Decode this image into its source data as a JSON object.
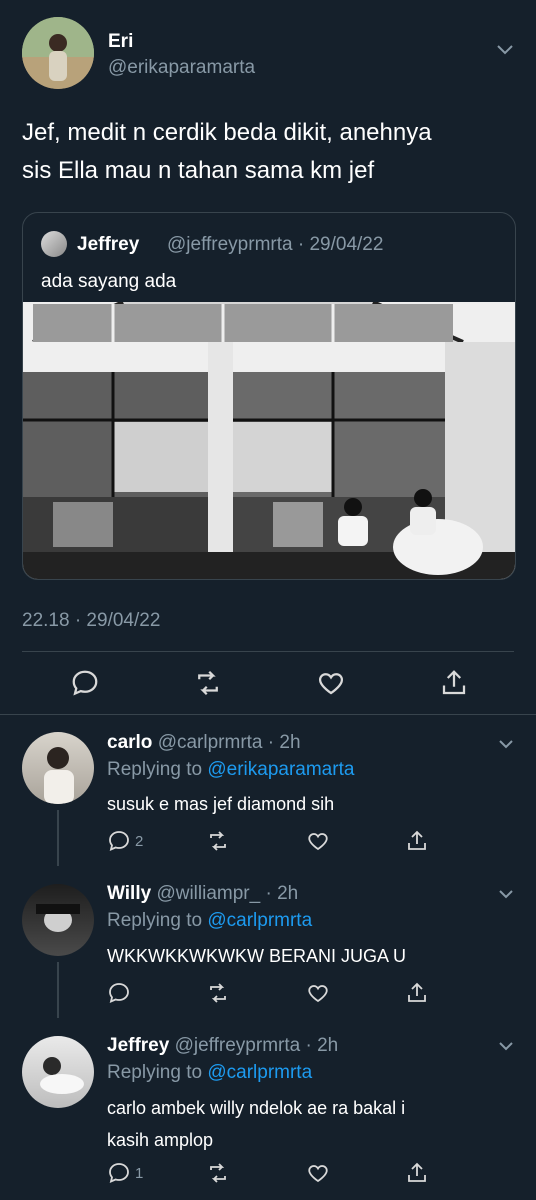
{
  "main_tweet": {
    "author_name": "Eri",
    "author_handle": "@erikaparamarta",
    "text_line1": "Jef, medit n cerdik beda dikit, anehnya",
    "text_line2": "sis Ella mau n tahan sama km jef",
    "quote": {
      "name": "Jeffrey",
      "meta": "@jeffreyprmrta · 29/04/22",
      "text": "ada sayang ada"
    },
    "timestamp": "22.18 · 29/04/22",
    "actions": [
      "reply-icon",
      "retweet-icon",
      "like-icon",
      "share-icon"
    ]
  },
  "replies": [
    {
      "name": "carlo",
      "meta": "@carlprmrta · 2h",
      "replying_prefix": "Replying to",
      "replying_to": "@erikaparamarta",
      "text": "susuk e mas jef diamond sih",
      "reply_count": "2"
    },
    {
      "name": "Willy",
      "meta": "@williampr_ · 2h",
      "replying_prefix": "Replying to",
      "replying_to": "@carlprmrta",
      "text": "WKKWKKWKWKW BERANI JUGA U",
      "reply_count": ""
    },
    {
      "name": "Jeffrey",
      "meta": "@jeffreyprmrta · 2h",
      "replying_prefix": "Replying to",
      "replying_to": "@carlprmrta",
      "text": "carlo ambek willy ndelok ae ra bakal i kasih amplop",
      "reply_count": "1"
    }
  ],
  "colors": {
    "background": "#15202b",
    "muted": "#8899a6",
    "link": "#1d9bf0",
    "divider": "#38444d"
  }
}
